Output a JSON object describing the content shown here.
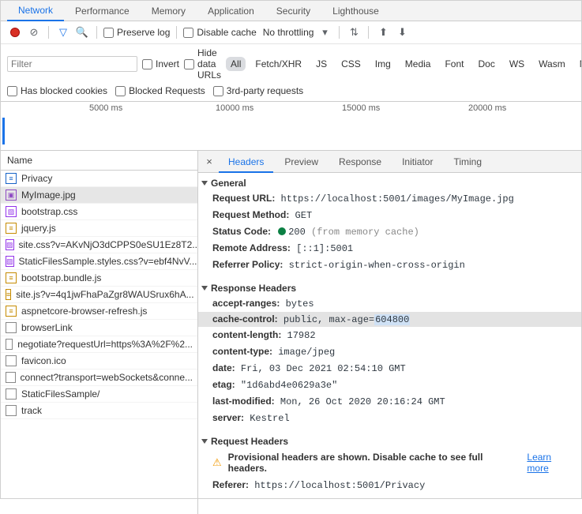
{
  "devtools_tabs": [
    "Network",
    "Performance",
    "Memory",
    "Application",
    "Security",
    "Lighthouse"
  ],
  "active_devtools_tab": "Network",
  "toolbar": {
    "preserve_log": "Preserve log",
    "disable_cache": "Disable cache",
    "throttling": "No throttling"
  },
  "filters": {
    "placeholder": "Filter",
    "invert": "Invert",
    "hide_data_urls": "Hide data URLs",
    "types": [
      "All",
      "Fetch/XHR",
      "JS",
      "CSS",
      "Img",
      "Media",
      "Font",
      "Doc",
      "WS",
      "Wasm",
      "Manife"
    ],
    "active_type": "All",
    "has_blocked_cookies": "Has blocked cookies",
    "blocked_requests": "Blocked Requests",
    "third_party": "3rd-party requests"
  },
  "timeline_ticks": [
    "5000 ms",
    "10000 ms",
    "15000 ms",
    "20000 ms"
  ],
  "name_header": "Name",
  "requests": [
    {
      "name": "Privacy",
      "icon": "doc"
    },
    {
      "name": "MyImage.jpg",
      "icon": "img",
      "selected": true
    },
    {
      "name": "bootstrap.css",
      "icon": "css"
    },
    {
      "name": "jquery.js",
      "icon": "js"
    },
    {
      "name": "site.css?v=AKvNjO3dCPPS0eSU1Ez8T2...",
      "icon": "css"
    },
    {
      "name": "StaticFilesSample.styles.css?v=ebf4NvV...",
      "icon": "css"
    },
    {
      "name": "bootstrap.bundle.js",
      "icon": "js"
    },
    {
      "name": "site.js?v=4q1jwFhaPaZgr8WAUSrux6hA...",
      "icon": "js"
    },
    {
      "name": "aspnetcore-browser-refresh.js",
      "icon": "js"
    },
    {
      "name": "browserLink",
      "icon": "xhr"
    },
    {
      "name": "negotiate?requestUrl=https%3A%2F%2...",
      "icon": "xhr"
    },
    {
      "name": "favicon.ico",
      "icon": "xhr"
    },
    {
      "name": "connect?transport=webSockets&conne...",
      "icon": "xhr"
    },
    {
      "name": "StaticFilesSample/",
      "icon": "xhr"
    },
    {
      "name": "track",
      "icon": "xhr"
    }
  ],
  "detail_tabs": [
    "Headers",
    "Preview",
    "Response",
    "Initiator",
    "Timing"
  ],
  "active_detail_tab": "Headers",
  "sections": {
    "general_title": "General",
    "response_title": "Response Headers",
    "request_title": "Request Headers"
  },
  "general": {
    "request_url_k": "Request URL:",
    "request_url_v": "https://localhost:5001/images/MyImage.jpg",
    "method_k": "Request Method:",
    "method_v": "GET",
    "status_k": "Status Code:",
    "status_v": "200",
    "status_suffix": " (from memory cache)",
    "remote_k": "Remote Address:",
    "remote_v": "[::1]:5001",
    "referrer_k": "Referrer Policy:",
    "referrer_v": "strict-origin-when-cross-origin"
  },
  "response_headers": [
    {
      "k": "accept-ranges:",
      "v": "bytes"
    },
    {
      "k": "cache-control:",
      "v_prefix": "public, max-age=",
      "v_hl": "604800",
      "highlight": true
    },
    {
      "k": "content-length:",
      "v": "17982"
    },
    {
      "k": "content-type:",
      "v": "image/jpeg"
    },
    {
      "k": "date:",
      "v": "Fri, 03 Dec 2021 02:54:10 GMT"
    },
    {
      "k": "etag:",
      "v": "\"1d6abd4e0629a3e\""
    },
    {
      "k": "last-modified:",
      "v": "Mon, 26 Oct 2020 20:16:24 GMT"
    },
    {
      "k": "server:",
      "v": "Kestrel"
    }
  ],
  "request_headers": {
    "provisional_msg": "Provisional headers are shown. Disable cache to see full headers.",
    "learn_more": "Learn more",
    "referer_k": "Referer:",
    "referer_v": "https://localhost:5001/Privacy"
  }
}
